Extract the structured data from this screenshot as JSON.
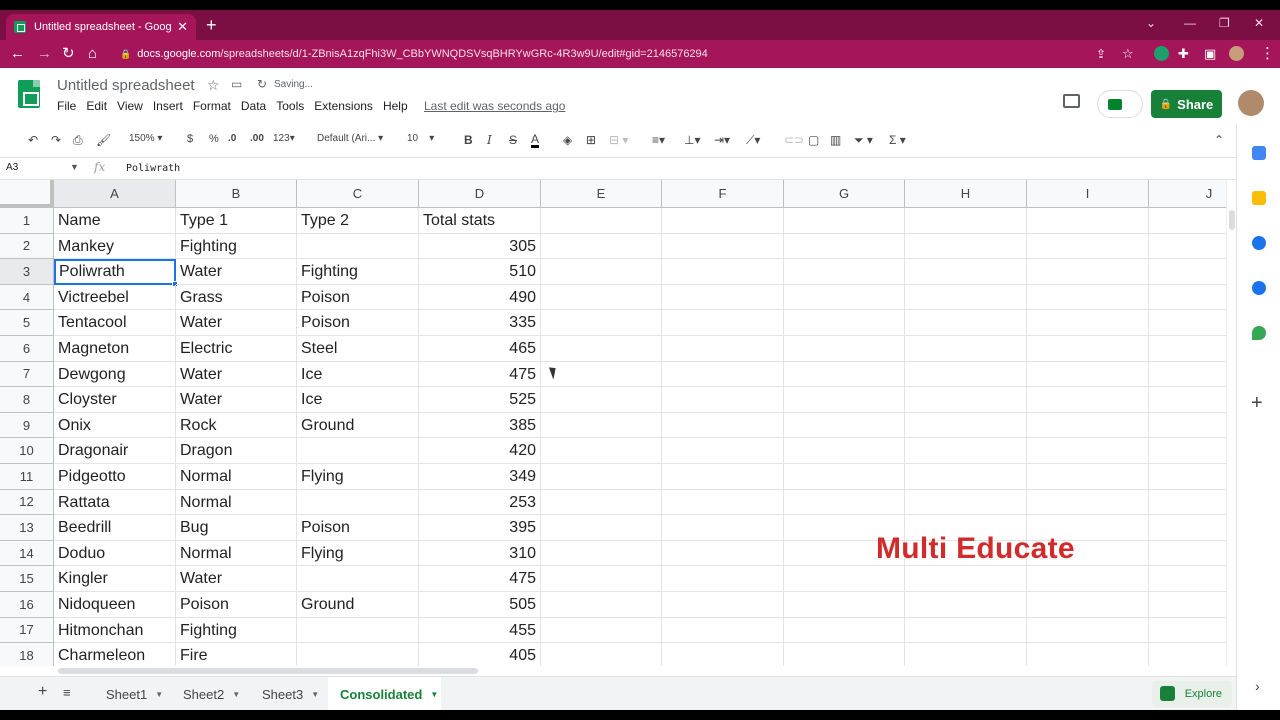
{
  "browser": {
    "tab_title": "Untitled spreadsheet - Google Sl",
    "tab_close": "✕",
    "new_tab": "+",
    "url_domain": "docs.google.com",
    "url_path": "/spreadsheets/d/1-ZBnisA1zqFhi3W_CBbYWNQDSVsqBHRYwGRc-4R3w9U/edit#gid=2146576294",
    "back": "←",
    "forward": "→",
    "reload": "↻",
    "home": "⌂"
  },
  "doc": {
    "title": "Untitled spreadsheet",
    "saving": "Saving...",
    "star": "☆",
    "last_edit": "Last edit was seconds ago",
    "share": "Share"
  },
  "menu": [
    "File",
    "Edit",
    "View",
    "Insert",
    "Format",
    "Data",
    "Tools",
    "Extensions",
    "Help"
  ],
  "toolbar": {
    "zoom": "150%",
    "currency": "$",
    "percent": "%",
    "dec_decrease": ".0",
    "dec_increase": ".00",
    "format_more": "123",
    "font": "Default (Ari...",
    "size": "10",
    "bold": "B",
    "italic": "I",
    "strike": "S",
    "textcolor": "A",
    "sum": "Σ"
  },
  "formula_bar": {
    "name_box": "A3",
    "fx": "fx",
    "value": "Poliwrath"
  },
  "columns": [
    "A",
    "B",
    "C",
    "D",
    "E",
    "F",
    "G",
    "H",
    "I",
    "J"
  ],
  "rows": [
    [
      "Name",
      "Type 1",
      "Type 2",
      "Total stats"
    ],
    [
      "Mankey",
      "Fighting",
      "",
      "305"
    ],
    [
      "Poliwrath",
      "Water",
      "Fighting",
      "510"
    ],
    [
      "Victreebel",
      "Grass",
      "Poison",
      "490"
    ],
    [
      "Tentacool",
      "Water",
      "Poison",
      "335"
    ],
    [
      "Magneton",
      "Electric",
      "Steel",
      "465"
    ],
    [
      "Dewgong",
      "Water",
      "Ice",
      "475"
    ],
    [
      "Cloyster",
      "Water",
      "Ice",
      "525"
    ],
    [
      "Onix",
      "Rock",
      "Ground",
      "385"
    ],
    [
      "Dragonair",
      "Dragon",
      "",
      "420"
    ],
    [
      "Pidgeotto",
      "Normal",
      "Flying",
      "349"
    ],
    [
      "Rattata",
      "Normal",
      "",
      "253"
    ],
    [
      "Beedrill",
      "Bug",
      "Poison",
      "395"
    ],
    [
      "Doduo",
      "Normal",
      "Flying",
      "310"
    ],
    [
      "Kingler",
      "Water",
      "",
      "475"
    ],
    [
      "Nidoqueen",
      "Poison",
      "Ground",
      "505"
    ],
    [
      "Hitmonchan",
      "Fighting",
      "",
      "455"
    ],
    [
      "Charmeleon",
      "Fire",
      "",
      "405"
    ]
  ],
  "watermark": "Multi Educate",
  "sheet_tabs": [
    "Sheet1",
    "Sheet2",
    "Sheet3",
    "Consolidated"
  ],
  "active_sheet": "Consolidated",
  "add_sheet": "+",
  "all_sheets": "≡",
  "explore": "Explore",
  "colors": {
    "chrome": "#a5155a",
    "accent_green": "#188038",
    "selection": "#1a73e8",
    "watermark": "#d12b2b"
  }
}
